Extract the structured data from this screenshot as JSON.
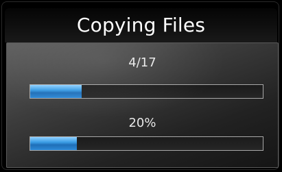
{
  "dialog": {
    "title": "Copying Files",
    "file_progress": {
      "text": "4/17",
      "current": 4,
      "total": 17,
      "fraction": 0.22
    },
    "percent_progress": {
      "text": "20%",
      "fraction": 0.2
    }
  },
  "colors": {
    "accent": "#2d89d6",
    "title_text": "#ffffff",
    "label_text": "#e8e8e8"
  }
}
